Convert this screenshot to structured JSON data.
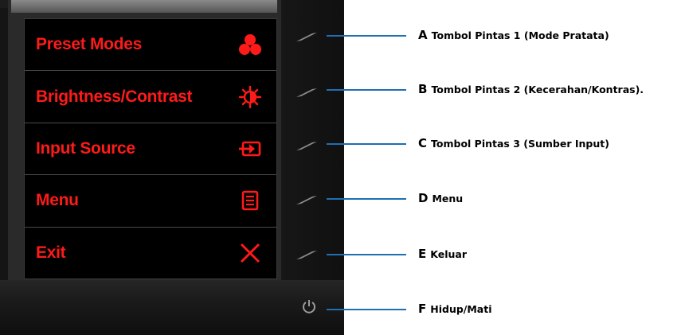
{
  "colors": {
    "osd_text": "#ff1a1a",
    "callout_line": "#1f6fb2",
    "button_icon": "#8a8a8a"
  },
  "osd": {
    "items": [
      {
        "label": "Preset Modes",
        "icon": "preset-modes-icon"
      },
      {
        "label": "Brightness/Contrast",
        "icon": "brightness-icon"
      },
      {
        "label": "Input Source",
        "icon": "input-source-icon"
      },
      {
        "label": "Menu",
        "icon": "menu-icon"
      },
      {
        "label": "Exit",
        "icon": "exit-icon"
      }
    ]
  },
  "callouts": [
    {
      "letter": "A",
      "text": "Tombol Pintas 1 (Mode Pratata)"
    },
    {
      "letter": "B",
      "text": "Tombol Pintas 2 (Kecerahan/Kontras)."
    },
    {
      "letter": "C",
      "text": "Tombol Pintas 3 (Sumber Input)"
    },
    {
      "letter": "D",
      "text": "Menu"
    },
    {
      "letter": "E",
      "text": "Keluar"
    },
    {
      "letter": "F",
      "text": "Hidup/Mati"
    }
  ]
}
